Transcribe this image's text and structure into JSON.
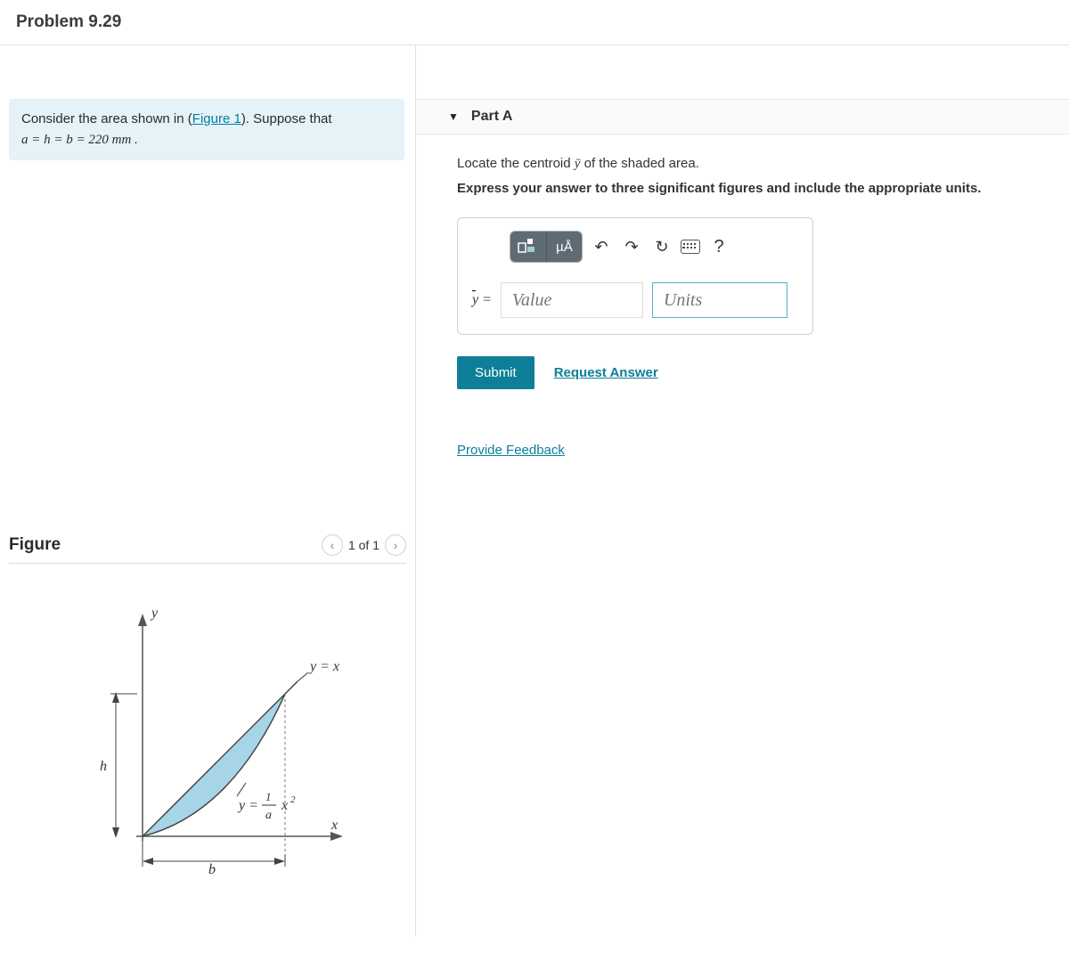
{
  "title": "Problem 9.29",
  "infobox": {
    "pre": "Consider the area shown in (",
    "figure_link": "Figure 1",
    "post": "). Suppose that ",
    "equation": "a = h = b = 220  mm ."
  },
  "figure_section": {
    "label": "Figure",
    "pager": {
      "current": 1,
      "total": 1,
      "text": "1 of 1"
    }
  },
  "figure_labels": {
    "y_axis": "y",
    "x_axis": "x",
    "curve1": "y = x",
    "curve2_lhs": "y =",
    "curve2_num": "1",
    "curve2_den": "a",
    "curve2_rhs": "x",
    "curve2_exp": "2",
    "h_label": "h",
    "b_label": "b"
  },
  "part": {
    "name": "Part A",
    "instruction1_pre": "Locate the centroid ",
    "instruction1_var": "ȳ",
    "instruction1_post": " of the shaded area.",
    "instruction2": "Express your answer to three significant figures and include the appropriate units.",
    "toolbar": {
      "template_icon": "templates-icon",
      "units_icon_label": "µÅ",
      "undo": "↶",
      "redo": "↷",
      "reset": "↻",
      "keyboard": "⌨",
      "help": "?"
    },
    "input": {
      "lhs": "ȳ =",
      "value_placeholder": "Value",
      "units_placeholder": "Units"
    },
    "submit_label": "Submit",
    "request_answer_label": "Request Answer"
  },
  "feedback_link": "Provide Feedback"
}
